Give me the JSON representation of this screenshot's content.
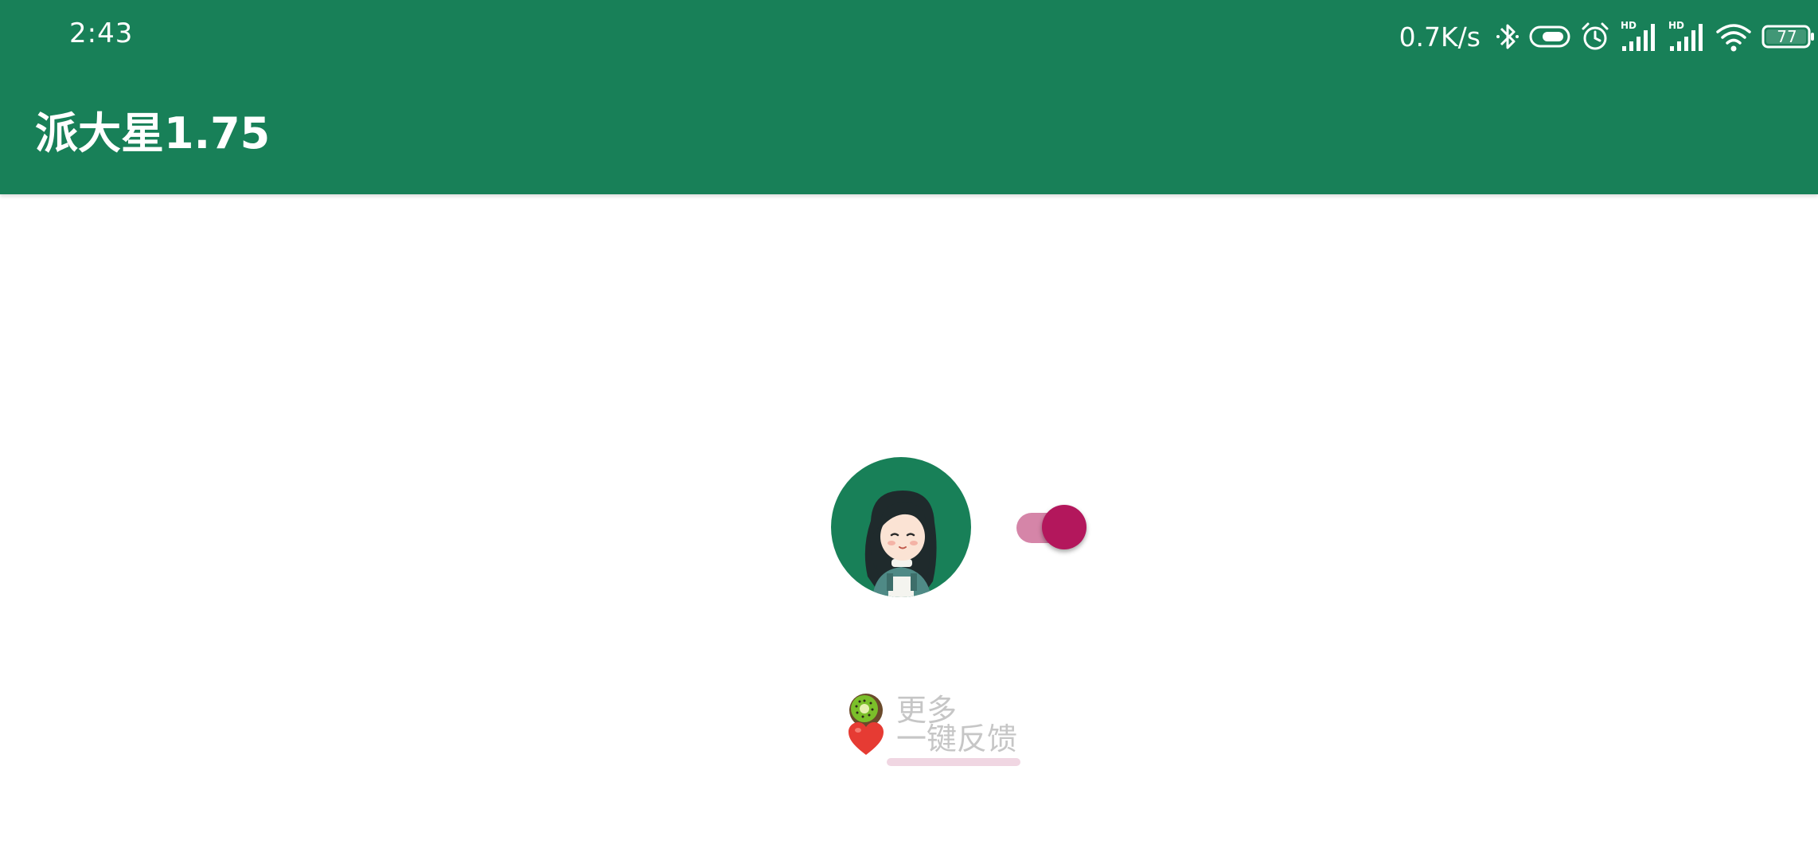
{
  "status_bar": {
    "time": "2:43",
    "net_speed": "0.7K/s",
    "battery": "77",
    "signal_label_1": "HD",
    "signal_label_2": "HD",
    "icons": [
      "bluetooth-icon",
      "toggle-icon",
      "alarm-icon",
      "signal-hd-icon",
      "signal-hd-icon",
      "wifi-icon",
      "battery-icon"
    ]
  },
  "app_bar": {
    "title": "派大星1.75",
    "color": "#188058"
  },
  "main": {
    "switch": {
      "checked": true,
      "thumb_color": "#b3175c",
      "track_color": "#d585a8"
    },
    "links": {
      "more_label": "更多",
      "feedback_label": "一键反馈"
    },
    "emojis": [
      "kiwi-icon",
      "heart-icon"
    ]
  }
}
